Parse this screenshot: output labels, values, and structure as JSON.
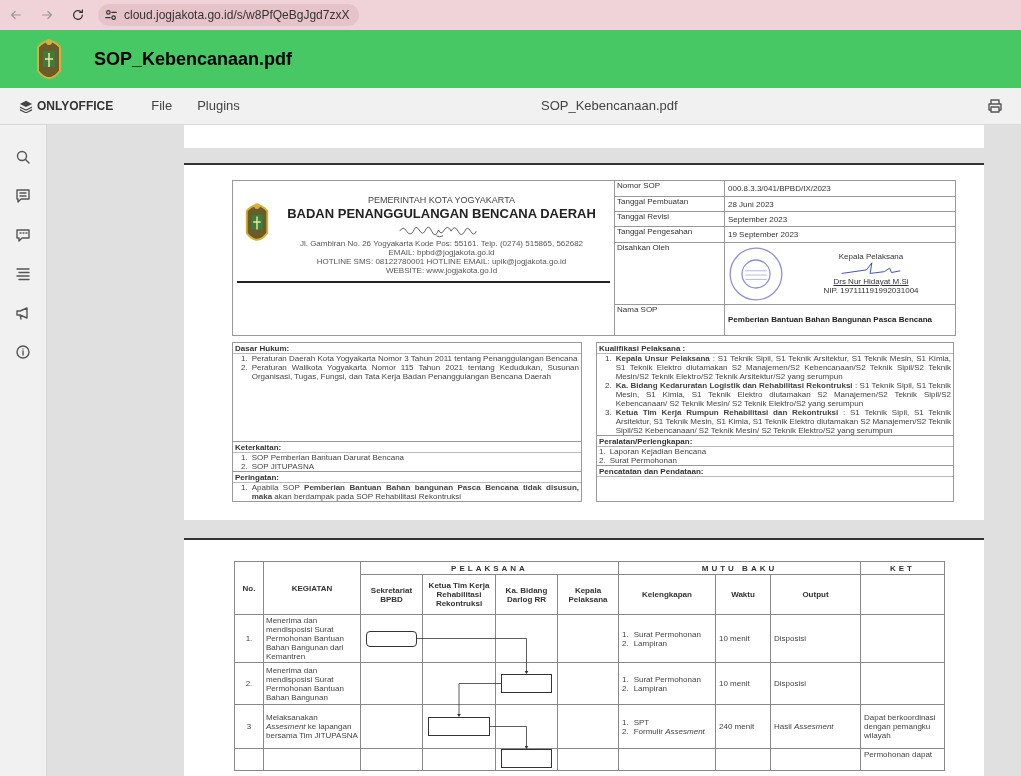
{
  "browser": {
    "url": "cloud.jogjakota.go.id/s/w8PfQeBgJgd7zxX"
  },
  "header": {
    "title": "SOP_Kebencanaan.pdf"
  },
  "toolbar": {
    "brand": "ONLYOFFICE",
    "menus": [
      "File",
      "Plugins"
    ],
    "document_title": "SOP_Kebencanaan.pdf"
  },
  "page_1": {
    "letterhead": {
      "government": "PEMERINTAH KOTA YOGYAKARTA",
      "agency": "BADAN PENANGGULANGAN BENCANA DAERAH",
      "address_lines": [
        "Jl. Gambiran No. 26 Yogyakarta Kode Pos: 55161. Telp. (0274) 515865, 562682",
        "EMAIL: bpbd@jogjakota.go.id",
        "HOTLINE SMS: 08122780001 HOTLINE EMAIL: upik@jogjakota.go.id",
        "WEBSITE: www.jogjakota.go.id"
      ]
    },
    "meta": [
      {
        "kind": "text",
        "label": "Nomor SOP",
        "value": "000.8.3.3/041/BPBD/IX/2023"
      },
      {
        "kind": "text",
        "label": "Tanggal Pembuatan",
        "value": "28 Juni 2023"
      },
      {
        "kind": "text",
        "label": "Tanggal Revisi",
        "value": "September 2023"
      },
      {
        "kind": "text",
        "label": "Tanggal Pengesahan",
        "value": "19 September 2023"
      },
      {
        "kind": "approval",
        "label": "Disahkan Oleh",
        "position": "Kepala Pelaksana",
        "name": "Drs Nur Hidayat M.Si",
        "nip": "NIP. 197111191992031004"
      },
      {
        "kind": "title",
        "label": "Nama SOP",
        "value": "Pemberian Bantuan Bahan Bangunan Pasca Bencana"
      }
    ],
    "boxes": [
      [
        {
          "heading": "Dasar Hukum:",
          "items": [
            {
              "no": "1.",
              "text": "Peraturan Daerah Kota Yogyakarta Nomor 3 Tahun 2011 tentang Penanggulangan Bencana"
            },
            {
              "no": "2.",
              "text": "Peraturan Walikota Yogyakarta Nomor 115 Tahun 2021 tentang Kedudukan, Susunan Organisasi, Tugas, Fungsi, dan Tata Kerja Badan Penanggulangan Bencana Daerah"
            }
          ]
        },
        {
          "heading": "Keterkaitan:",
          "items": [
            {
              "no": "1.",
              "text": "SOP Pemberian Bantuan Darurat Bencana"
            },
            {
              "no": "2.",
              "text": "SOP JITUPASNA"
            }
          ]
        },
        {
          "heading": "Peringatan:",
          "items": [
            {
              "no": "1.",
              "text": "Apabila SOP **Pemberian Bantuan Bahan bangunan Pasca Bencana tidak disusun, maka** akan berdampak pada SOP Rehabilitasi Rekontruksi"
            }
          ]
        }
      ],
      [
        {
          "heading": "Kualifikasi Pelaksana :",
          "items": [
            {
              "no": "1.",
              "text": "**Kepala Unsur Pelaksana** : S1 Teknik Sipil, S1 Teknik Arsitektur, S1 Teknik Mesin, S1 Kimia, S1 Teknik Elektro diutamakan S2 Manajemen/S2 Kebencanaan/S2 Teknik Sipil/S2 Teknik Mesin/S2 Teknik Elektro/S2 Teknik Arsitektur/S2 yang serumpun"
            },
            {
              "no": "2.",
              "text": "**Ka. Bidang Kedaruratan Logistik dan Rehabilitasi Rekontruksi** : S1 Teknik Sipil, S1 Teknik Mesin, S1 Kimia, S1 Teknik Elektro diutamakan S2 Manajemen/S2 Teknik Sipil/S2 Kebencanaan/ S2 Teknik Mesin/ S2 Teknik Elektro/S2 yang serumpun"
            },
            {
              "no": "3.",
              "text": "**Ketua Tim Kerja Rumpun Rehabilitasi dan Rekontruksi** : S1 Teknik Sipil, S1 Teknik Arsitektur, S1 Teknik Mesin, S1 Kimia, S1 Teknik Elektro diutamakan S2 Manajemen/S2 Teknik Sipil/S2 Kebencanaan/ S2 Teknik Mesin/ S2 Teknik Elektro/S2 yang serumpun"
            }
          ]
        },
        {
          "heading": "Peralatan/Perlengkapan:",
          "items": [
            {
              "no": "1.",
              "text": "Laporan Kejadian Bencana"
            },
            {
              "no": "2.",
              "text": "Surat Permohonan"
            }
          ]
        },
        {
          "heading": "Pencatatan dan Pendataan:"
        }
      ]
    ]
  },
  "page_2": {
    "groups": [
      "PELAKSANA",
      "MUTU BAKU",
      "KET"
    ],
    "columns": [
      "No.",
      "KEGIATAN",
      "Sekretariat BPBD",
      "Ketua Tim Kerja Rehabilitasi Rekontruksi",
      "Ka. Bidang Darlog RR",
      "Kepala Pelaksana",
      "Kelengkapan",
      "Waktu",
      "Output"
    ],
    "rows": [
      {
        "no": "1.",
        "kegiatan": "Menerima dan mendisposisi Surat Permohonan Bantuan Bahan Bangunan dari Kemantren",
        "kind": "start",
        "executors": [
          true,
          false,
          false,
          false
        ],
        "kelengkapan": [
          {
            "no": "1.",
            "text": "Surat Permohonan"
          },
          {
            "no": "2.",
            "text": "Lampiran"
          }
        ],
        "waktu": "10 menit",
        "output": "Disposisi"
      },
      {
        "no": "2.",
        "kegiatan": "Menerima dan mendisposisi Surat Permohonan Bantuan Bahan Bangunan",
        "kind": "step",
        "executors": [
          false,
          false,
          true,
          false
        ],
        "kelengkapan": [
          {
            "no": "1.",
            "text": "Surat Permohonan"
          },
          {
            "no": "2.",
            "text": "Lampiran"
          }
        ],
        "waktu": "10 menit",
        "output": "Disposisi"
      },
      {
        "no": "3",
        "kegiatan": "Melaksanakan *Assesment* ke lapangan bersama Tim JITUPASNA",
        "kind": "step",
        "executors": [
          false,
          true,
          false,
          false
        ],
        "kelengkapan": [
          {
            "no": "1.",
            "text": "SPT"
          },
          {
            "no": "2.",
            "text": "Formulir *Assesment*"
          }
        ],
        "waktu": "240 menit",
        "output": "Hasil *Assesment*",
        "ket": "Dapat berkoordinasi dengan pemangku wilayah"
      },
      {
        "kind": "step",
        "executors": [
          false,
          false,
          true,
          false
        ],
        "ket": "Permohonan dapat"
      }
    ]
  }
}
